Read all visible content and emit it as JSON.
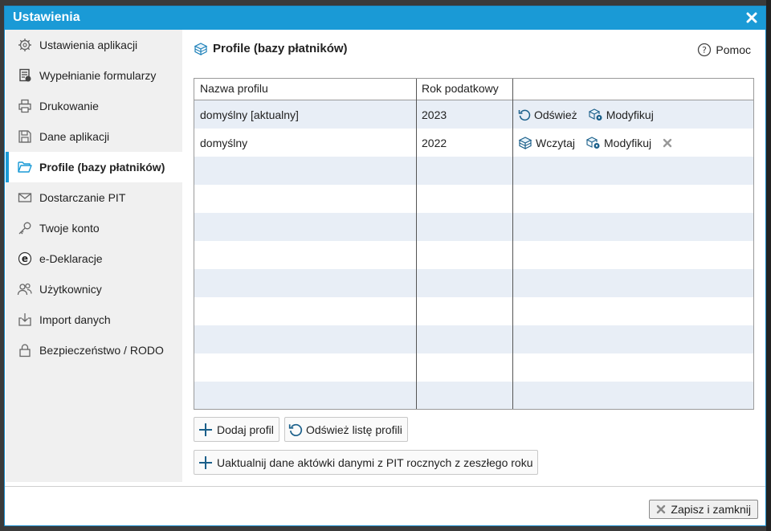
{
  "window": {
    "title": "Ustawienia"
  },
  "sidebar": {
    "items": [
      {
        "label": "Ustawienia aplikacji",
        "icon": "gear-icon"
      },
      {
        "label": "Wypełnianie formularzy",
        "icon": "form-fill-icon"
      },
      {
        "label": "Drukowanie",
        "icon": "printer-icon"
      },
      {
        "label": "Dane aplikacji",
        "icon": "floppy-disk-icon"
      },
      {
        "label": "Profile (bazy płatników)",
        "icon": "folder-open-icon",
        "active": true
      },
      {
        "label": "Dostarczanie PIT",
        "icon": "envelope-icon"
      },
      {
        "label": "Twoje konto",
        "icon": "key-icon"
      },
      {
        "label": "e-Deklaracje",
        "icon": "e-declaration-icon"
      },
      {
        "label": "Użytkownicy",
        "icon": "users-icon"
      },
      {
        "label": "Import danych",
        "icon": "import-icon"
      },
      {
        "label": "Bezpieczeństwo / RODO",
        "icon": "lock-icon"
      }
    ]
  },
  "main": {
    "title": "Profile (bazy płatników)",
    "help_label": "Pomoc",
    "table": {
      "headers": [
        "Nazwa profilu",
        "Rok podatkowy",
        ""
      ],
      "rows": [
        {
          "name": "domyślny [aktualny]",
          "year": "2023",
          "actions": [
            "Odśwież",
            "Modyfikuj"
          ]
        },
        {
          "name": "domyślny",
          "year": "2022",
          "actions": [
            "Wczytaj",
            "Modyfikuj"
          ]
        }
      ]
    },
    "buttons": {
      "add_profile": "Dodaj profil",
      "refresh_list": "Odśwież listę profili",
      "update_briefcase": "Uaktualnij dane aktówki danymi z PIT rocznych z zeszłego roku"
    }
  },
  "footer": {
    "save_close": "Zapisz i zamknij"
  },
  "colors": {
    "accent": "#1a9ad6",
    "row_alt": "#e8eef6",
    "sidebar_bg": "#f0f0f0"
  }
}
